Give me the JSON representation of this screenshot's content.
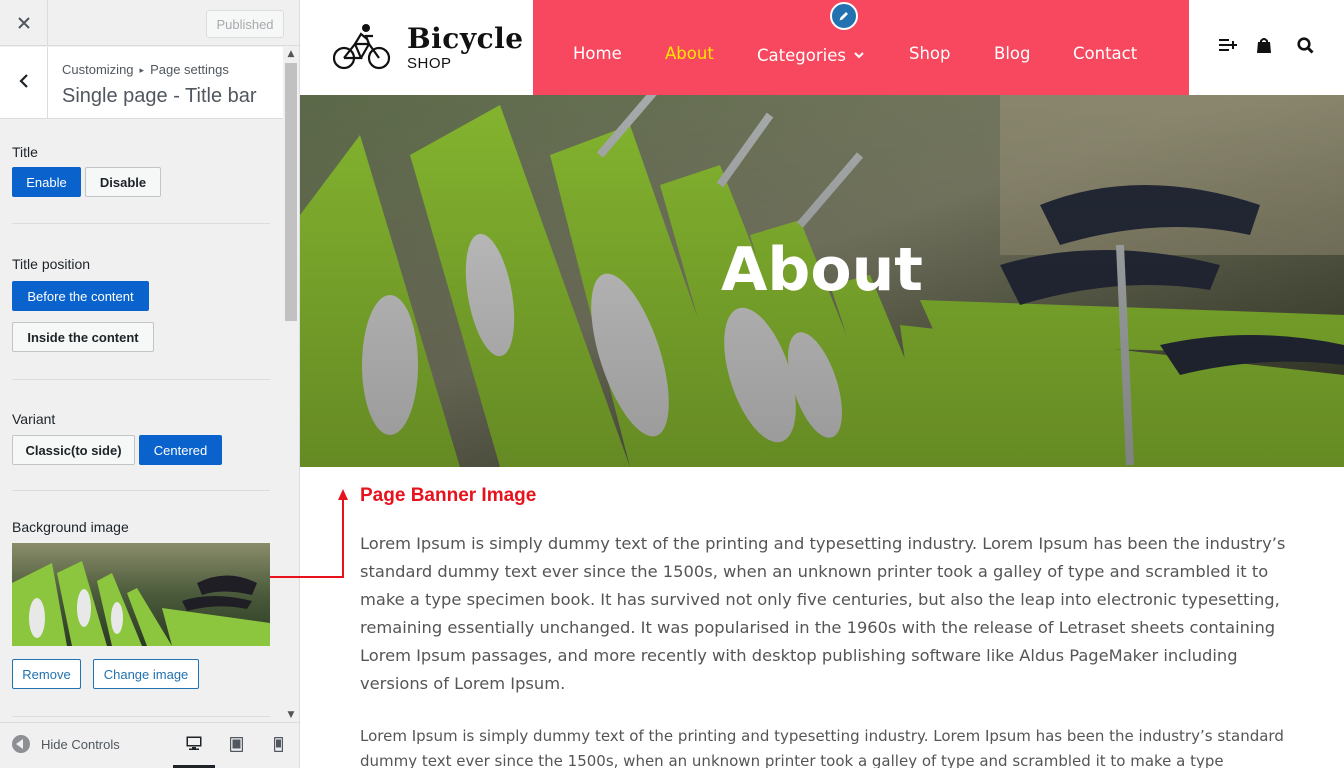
{
  "customizer": {
    "published_label": "Published",
    "breadcrumb": {
      "root": "Customizing",
      "section": "Page settings"
    },
    "section_title": "Single page - Title bar",
    "controls": {
      "title": {
        "label": "Title",
        "options": [
          "Enable",
          "Disable"
        ],
        "selected": "Enable"
      },
      "title_position": {
        "label": "Title position",
        "options": [
          "Before the content",
          "Inside the content"
        ],
        "selected": "Before the content"
      },
      "variant": {
        "label": "Variant",
        "options": [
          "Classic(to side)",
          "Centered"
        ],
        "selected": "Centered"
      },
      "background_image": {
        "label": "Background image",
        "remove_label": "Remove",
        "change_label": "Change image"
      }
    },
    "footer": {
      "hide_controls_label": "Hide Controls",
      "devices": [
        "desktop",
        "tablet",
        "mobile"
      ],
      "active_device": "desktop"
    }
  },
  "site": {
    "logo": {
      "title": "Bicycle",
      "subtitle": "SHOP"
    },
    "nav": {
      "items": [
        "Home",
        "About",
        "Categories",
        "Shop",
        "Blog",
        "Contact"
      ],
      "current": "About",
      "background": "#f7485f",
      "current_color": "#ffe600"
    },
    "header_icons": [
      "menu-plus-icon",
      "shopping-bag-icon",
      "search-icon"
    ],
    "banner_title": "About",
    "annotation": "Page Banner Image",
    "paragraphs": [
      "Lorem Ipsum is simply dummy text of the printing and typesetting industry. Lorem Ipsum has been the industry’s standard dummy text ever since the 1500s, when an unknown printer took a galley of type and scrambled it to make a type specimen book. It has survived not only five centuries, but also the leap into electronic typesetting, remaining essentially unchanged. It was popularised in the 1960s with the release of Letraset sheets containing Lorem Ipsum passages, and more recently with desktop publishing software like Aldus PageMaker including versions of Lorem Ipsum.",
      "Lorem Ipsum is simply dummy text of the printing and typesetting industry. Lorem Ipsum has been the industry’s standard dummy text ever since the 1500s, when an unknown printer took a galley of type and scrambled it to make a type specimen"
    ]
  },
  "colors": {
    "accent_blue": "#0a63cc",
    "annotation_red": "#e8121d",
    "bike_green": "#8cc63f"
  }
}
